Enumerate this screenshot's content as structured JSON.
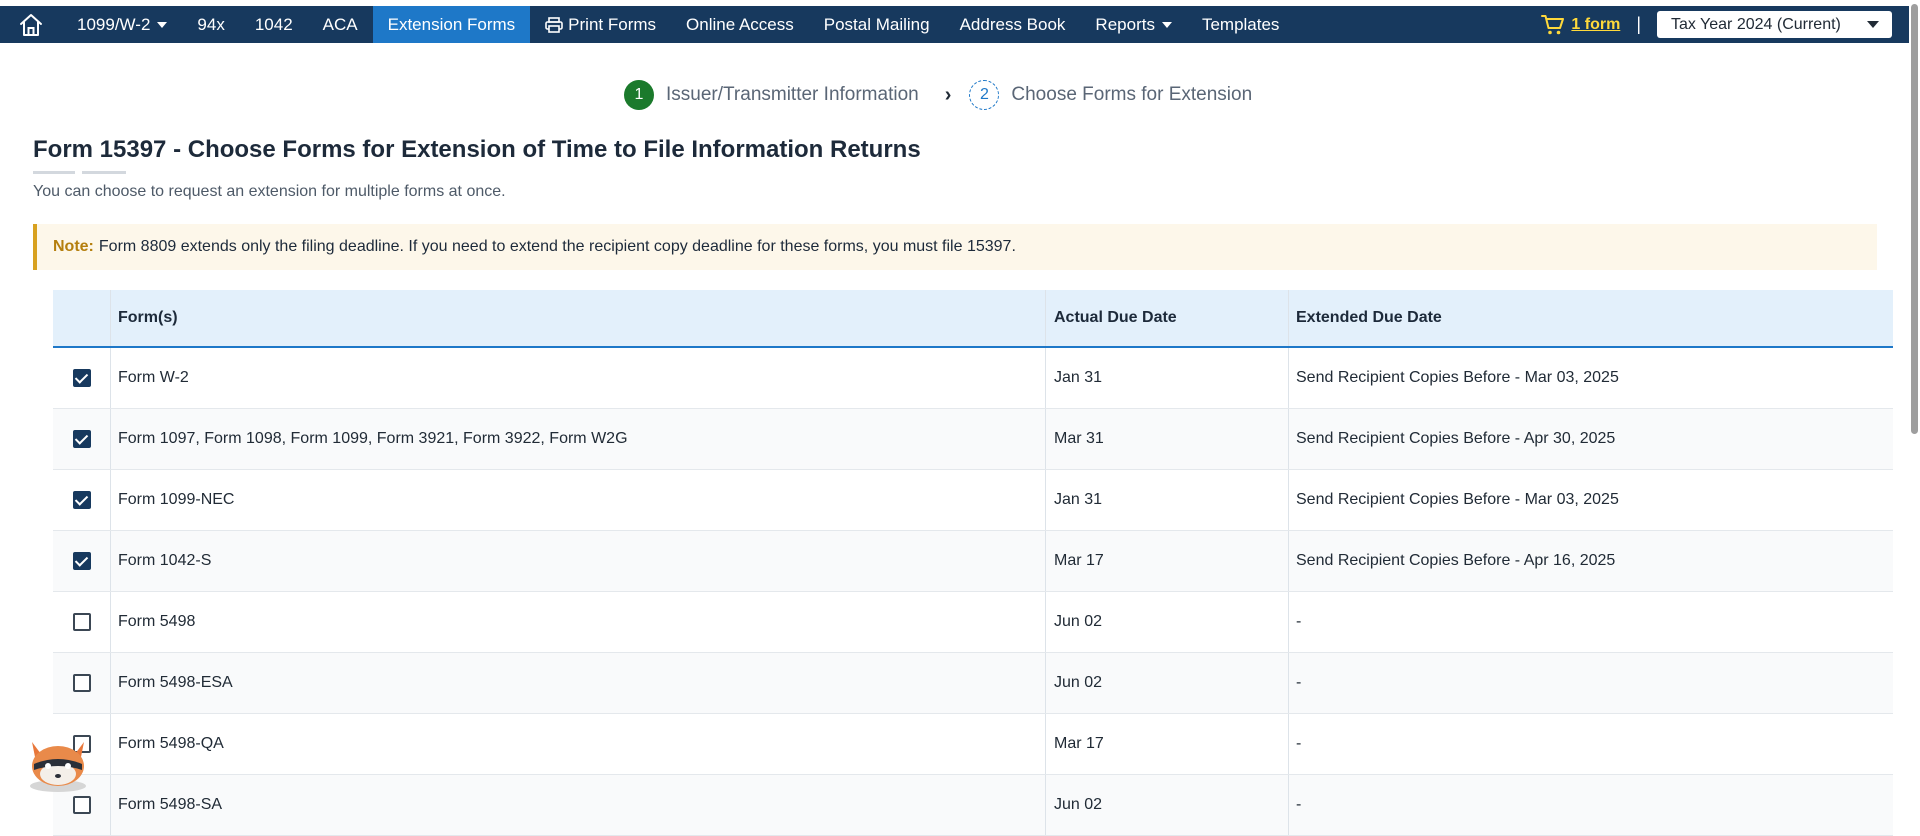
{
  "nav": {
    "items": [
      {
        "label": "1099/W-2",
        "dropdown": true
      },
      {
        "label": "94x"
      },
      {
        "label": "1042"
      },
      {
        "label": "ACA"
      },
      {
        "label": "Extension Forms",
        "active": true
      },
      {
        "label": "Print Forms",
        "icon": "printer-icon"
      },
      {
        "label": "Online Access"
      },
      {
        "label": "Postal Mailing"
      },
      {
        "label": "Address Book"
      },
      {
        "label": "Reports",
        "dropdown": true
      },
      {
        "label": "Templates"
      }
    ],
    "cart_label": "1 form",
    "separator": "|",
    "tax_year": "Tax Year 2024 (Current)"
  },
  "stepper": {
    "steps": [
      {
        "number": "1",
        "label": "Issuer/Transmitter Information"
      },
      {
        "number": "2",
        "label": "Choose Forms for Extension"
      }
    ]
  },
  "page": {
    "title": "Form 15397 - Choose Forms for Extension of Time to File Information Returns",
    "subtitle": "You can choose to request an extension for multiple forms at once.",
    "note_label": "Note:",
    "note_text": "Form 8809 extends only the filing deadline. If you need to extend the recipient copy deadline for these forms, you must file 15397."
  },
  "table": {
    "headers": {
      "forms": "Form(s)",
      "actual": "Actual Due Date",
      "extended": "Extended Due Date"
    },
    "rows": [
      {
        "checked": true,
        "forms": "Form W-2",
        "actual": "Jan 31",
        "extended": "Send Recipient Copies Before - Mar 03, 2025"
      },
      {
        "checked": true,
        "forms": "Form 1097, Form 1098, Form 1099, Form 3921, Form 3922, Form W2G",
        "actual": "Mar 31",
        "extended": "Send Recipient Copies Before - Apr 30, 2025"
      },
      {
        "checked": true,
        "forms": "Form 1099-NEC",
        "actual": "Jan 31",
        "extended": "Send Recipient Copies Before - Mar 03, 2025"
      },
      {
        "checked": true,
        "forms": "Form 1042-S",
        "actual": "Mar 17",
        "extended": "Send Recipient Copies Before - Apr 16, 2025"
      },
      {
        "checked": false,
        "forms": "Form 5498",
        "actual": "Jun 02",
        "extended": "-"
      },
      {
        "checked": false,
        "forms": "Form 5498-ESA",
        "actual": "Jun 02",
        "extended": "-"
      },
      {
        "checked": false,
        "forms": "Form 5498-QA",
        "actual": "Mar 17",
        "extended": "-"
      },
      {
        "checked": false,
        "forms": "Form 5498-SA",
        "actual": "Jun 02",
        "extended": "-"
      }
    ]
  },
  "colors": {
    "nav_bg": "#17395e",
    "nav_active": "#1e78c8",
    "accent_yellow": "#ffd93b",
    "step_done": "#1b7a2c",
    "note_bg": "#fdf7ea",
    "note_border": "#d8a11f"
  }
}
